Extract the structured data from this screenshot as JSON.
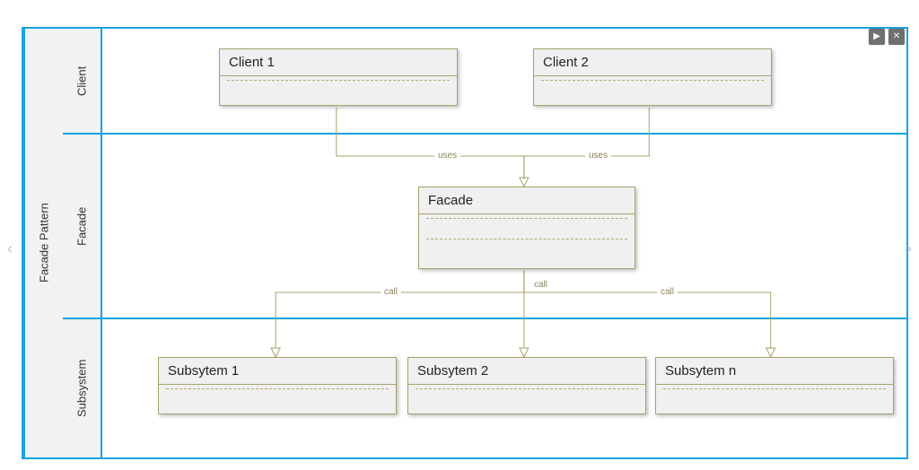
{
  "diagram_title": "Facade Pattern",
  "lanes": {
    "client": "Client",
    "facade": "Facade",
    "subsystem": "Subsystem"
  },
  "nodes": {
    "client1": "Client 1",
    "client2": "Client 2",
    "facade": "Facade",
    "sub1": "Subsytem 1",
    "sub2": "Subsytem 2",
    "subn": "Subsytem n"
  },
  "edge_labels": {
    "uses": "uses",
    "call": "call"
  },
  "controls": {
    "play": "▶",
    "close": "✕",
    "prev": "‹",
    "next": "›"
  },
  "colors": {
    "swimlane_border": "#18a3e0",
    "uml_border": "#a7a26a"
  }
}
